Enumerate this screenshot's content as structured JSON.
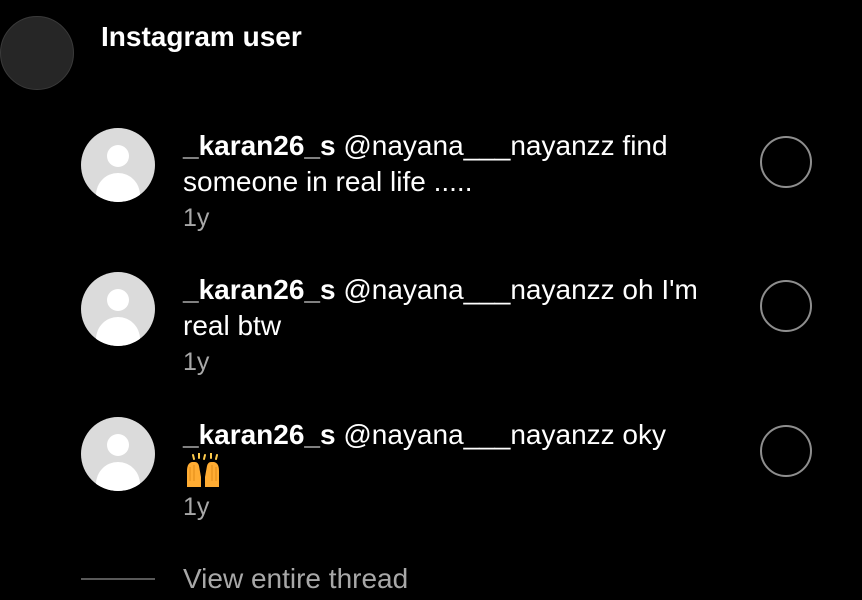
{
  "header": {
    "title": "Instagram user"
  },
  "comments": [
    {
      "username": "_karan26_s",
      "text": " @nayana___nayanzz find someone in real life .....",
      "time": "1y"
    },
    {
      "username": "_karan26_s",
      "text": " @nayana___nayanzz oh I'm real btw",
      "time": "1y"
    },
    {
      "username": "_karan26_s",
      "text": " @nayana___nayanzz oky",
      "emoji": "raising-hands-emoji",
      "time": "1y"
    }
  ],
  "footer": {
    "view_thread": "View entire thread"
  },
  "colors": {
    "background": "#000000",
    "text": "#ffffff",
    "secondary_text": "#a8a8a8",
    "avatar_placeholder": "#dbdbdb",
    "circle_border": "#8e8e8e"
  }
}
